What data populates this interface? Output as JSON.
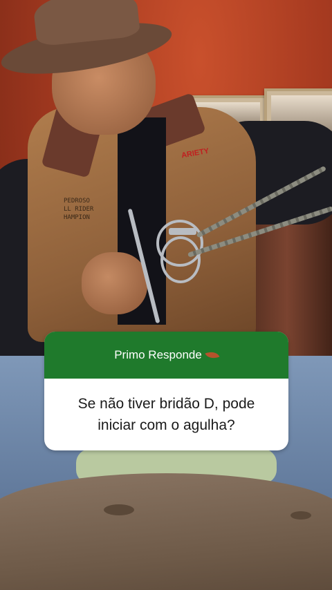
{
  "card": {
    "title": "Primo Responde",
    "title_icon": "leaf-icon",
    "question": "Se não tiver bridão D, pode iniciar com o agulha?",
    "header_color": "#1f7a2c",
    "body_color": "#ffffff"
  },
  "vest_patch": {
    "line1": "PEDROSO",
    "line2": "LL RIDER",
    "line3": "HAMPION"
  },
  "vest_logo": "ARIETY"
}
